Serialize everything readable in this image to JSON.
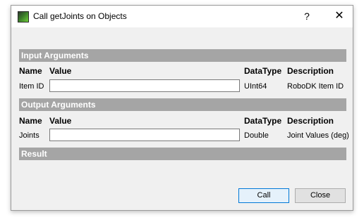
{
  "window": {
    "title": "Call getJoints on Objects",
    "help_label": "?",
    "close_label": "✕"
  },
  "sections": {
    "input": "Input Arguments",
    "output": "Output Arguments",
    "result": "Result"
  },
  "columns": {
    "name": "Name",
    "value": "Value",
    "datatype": "DataType",
    "description": "Description"
  },
  "input_args": [
    {
      "name": "Item ID",
      "value": "",
      "datatype": "UInt64",
      "description": "RoboDK Item ID"
    }
  ],
  "output_args": [
    {
      "name": "Joints",
      "value": "",
      "datatype": "Double",
      "description": "Joint Values (deg)"
    }
  ],
  "buttons": {
    "call": "Call",
    "close": "Close"
  }
}
